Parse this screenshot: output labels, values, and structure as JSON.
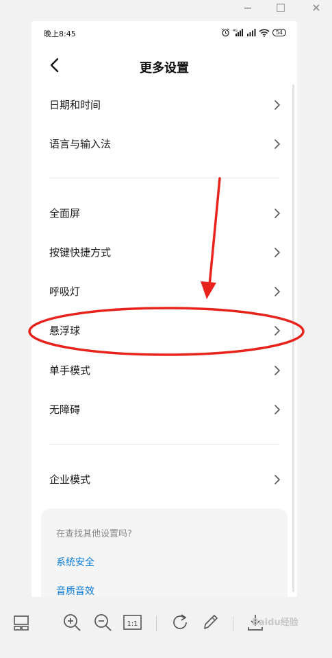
{
  "window": {
    "minimize_glyph": "−",
    "maximize_glyph": "☐",
    "close_glyph": "✕"
  },
  "status_bar": {
    "time": "晚上8:45",
    "battery": "54",
    "icons": [
      "alarm-icon",
      "signal-4g-icon",
      "signal-icon",
      "wifi-icon",
      "battery-icon"
    ]
  },
  "header": {
    "title": "更多设置"
  },
  "settings": {
    "group1": [
      {
        "label": "日期和时间"
      },
      {
        "label": "语言与输入法"
      }
    ],
    "group2": [
      {
        "label": "全面屏"
      },
      {
        "label": "按键快捷方式"
      },
      {
        "label": "呼吸灯"
      },
      {
        "label": "悬浮球"
      },
      {
        "label": "单手模式"
      },
      {
        "label": "无障碍"
      }
    ],
    "group3": [
      {
        "label": "企业模式"
      }
    ]
  },
  "suggestions": {
    "hint": "在查找其他设置吗?",
    "links": [
      "系统安全",
      "音质音效"
    ]
  },
  "toolbar": {
    "actual_size_label": "1:1",
    "buttons": [
      "gallery-icon",
      "zoom-in-icon",
      "zoom-out-icon",
      "actual-size-icon",
      "rotate-icon",
      "edit-icon",
      "download-icon"
    ]
  },
  "colors": {
    "link": "#0a7bd6",
    "annotation": "#e8231b"
  },
  "watermark": "Baidu经验"
}
